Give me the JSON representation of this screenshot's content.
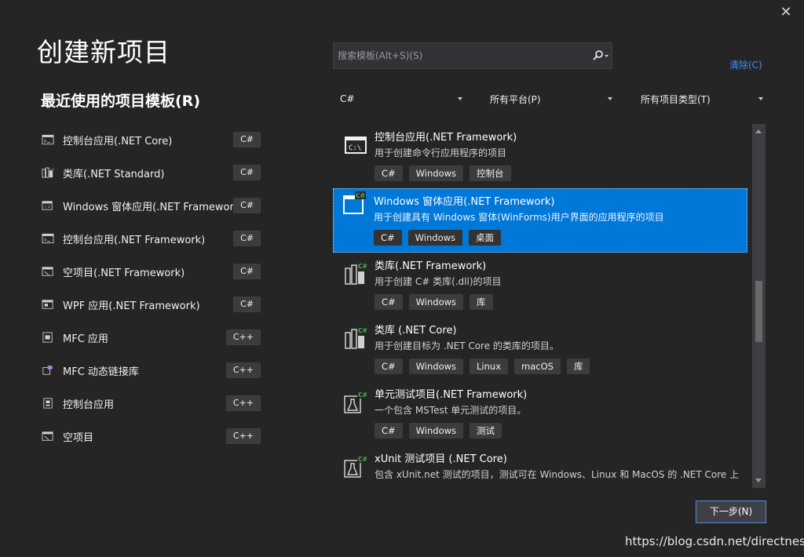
{
  "window": {
    "close_label": "✕"
  },
  "page": {
    "title": "创建新项目",
    "recent_heading": "最近使用的项目模板(R)"
  },
  "search": {
    "placeholder": "搜索模板(Alt+S)(S)",
    "value": "",
    "clear_label": "清除(C)"
  },
  "filters": {
    "language": "C#",
    "platform": "所有平台(P)",
    "project_type": "所有项目类型(T)"
  },
  "recent_templates": [
    {
      "label": "控制台应用(.NET Core)",
      "lang": "C#",
      "icon": "console-icon"
    },
    {
      "label": "类库(.NET Standard)",
      "lang": "C#",
      "icon": "class-library-icon"
    },
    {
      "label": "Windows 窗体应用(.NET Framework)",
      "lang": "C#",
      "icon": "windows-form-icon"
    },
    {
      "label": "控制台应用(.NET Framework)",
      "lang": "C#",
      "icon": "console-icon"
    },
    {
      "label": "空项目(.NET Framework)",
      "lang": "C#",
      "icon": "empty-project-icon"
    },
    {
      "label": "WPF 应用(.NET Framework)",
      "lang": "C#",
      "icon": "wpf-app-icon"
    },
    {
      "label": "MFC 应用",
      "lang": "C++",
      "icon": "mfc-app-icon"
    },
    {
      "label": "MFC 动态链接库",
      "lang": "C++",
      "icon": "mfc-dll-icon"
    },
    {
      "label": "控制台应用",
      "lang": "C++",
      "icon": "console-app-icon"
    },
    {
      "label": "空项目",
      "lang": "C++",
      "icon": "empty-project-icon"
    }
  ],
  "templates": [
    {
      "name": "控制台应用(.NET Framework)",
      "desc": "用于创建命令行应用程序的项目",
      "tags": [
        "C#",
        "Windows",
        "控制台"
      ],
      "icon": "console-icon",
      "selected": false
    },
    {
      "name": "Windows 窗体应用(.NET Framework)",
      "desc": "用于创建具有 Windows 窗体(WinForms)用户界面的应用程序的项目",
      "tags": [
        "C#",
        "Windows",
        "桌面"
      ],
      "icon": "windows-form-icon",
      "selected": true
    },
    {
      "name": "类库(.NET Framework)",
      "desc": "用于创建 C# 类库(.dll)的项目",
      "tags": [
        "C#",
        "Windows",
        "库"
      ],
      "icon": "class-library-icon",
      "selected": false
    },
    {
      "name": "类库 (.NET Core)",
      "desc": "用于创建目标为 .NET Core 的类库的项目。",
      "tags": [
        "C#",
        "Windows",
        "Linux",
        "macOS",
        "库"
      ],
      "icon": "class-library-icon",
      "selected": false
    },
    {
      "name": "单元测试项目(.NET Framework)",
      "desc": "一个包含 MSTest 单元测试的项目。",
      "tags": [
        "C#",
        "Windows",
        "测试"
      ],
      "icon": "unit-test-icon",
      "selected": false
    },
    {
      "name": "xUnit 测试项目 (.NET Core)",
      "desc": "包含 xUnit.net 测试的项目，测试可在 Windows、Linux 和 MacOS 的 .NET Core 上",
      "tags": [],
      "icon": "unit-test-icon",
      "selected": false
    }
  ],
  "footer": {
    "next_label": "下一步(N)",
    "watermark": "https://blog.csdn.net/directness"
  },
  "colors": {
    "background": "#252526",
    "accent": "#0078d7",
    "link": "#3794ff"
  }
}
